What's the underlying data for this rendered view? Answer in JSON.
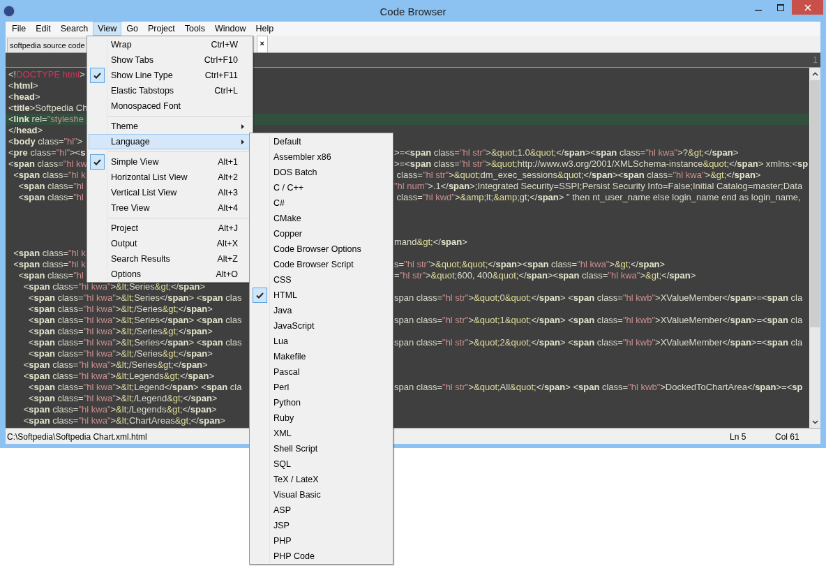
{
  "window": {
    "title": "Code Browser"
  },
  "menu_bar": [
    {
      "label": "File",
      "selected": false
    },
    {
      "label": "Edit",
      "selected": false
    },
    {
      "label": "Search",
      "selected": false
    },
    {
      "label": "View",
      "selected": true
    },
    {
      "label": "Go",
      "selected": false
    },
    {
      "label": "Project",
      "selected": false
    },
    {
      "label": "Tools",
      "selected": false
    },
    {
      "label": "Window",
      "selected": false
    },
    {
      "label": "Help",
      "selected": false
    }
  ],
  "tabs": [
    {
      "label": "softpedia source code",
      "selected": false
    },
    {
      "close": "×",
      "selected": true
    }
  ],
  "editor": {
    "header_number": "1",
    "lines": [
      {
        "left": "<!DOCTYPE html>",
        "current": false
      },
      {
        "left": "<html>",
        "current": false
      },
      {
        "left": "<head>",
        "current": false
      },
      {
        "left": "<title>Softpedia Ch",
        "current": false
      },
      {
        "left": "<link rel=\"styleshe",
        "current": true
      },
      {
        "left": "</head>",
        "current": false
      },
      {
        "left": "<body class=\"hl\">",
        "current": false
      },
      {
        "left": "<pre class=\"hl\"><s",
        "right": ">=<span class=\"hl str\">&quot;1.0&quot;</span><span class=\"hl kwa\">?&gt;</span>",
        "current": false
      },
      {
        "left": "<span class=\"hl kw",
        "right": ">=<span class=\"hl str\">&quot;http://www.w3.org/2001/XMLSchema-instance&quot;</span> xmlns:<sp",
        "current": false
      },
      {
        "left": "  <span class=\"hl k",
        "right": " class=\"hl str\">&quot;dm_exec_sessions&quot;</span><span class=\"hl kwa\">&gt;</span>",
        "current": false
      },
      {
        "left": "    <span class=\"hl",
        "right": "\"hl num\">.1</span>;Integrated Security=SSPI;Persist Security Info=False;Initial Catalog=master;Data",
        "current": false
      },
      {
        "left": "    <span class=\"hl",
        "right": " class=\"hl kwd\">&amp;lt;&amp;gt;</span> \" then nt_user_name else login_name end as login_name,",
        "current": false
      },
      {
        "current": false
      },
      {
        "current": false
      },
      {
        "current": false
      },
      {
        "right": "mand&gt;</span>",
        "current": false
      },
      {
        "left": "  <span class=\"hl k",
        "current": false
      },
      {
        "left": "  <span class=\"hl k",
        "right": "s=\"hl str\">&quot;&quot;</span><span class=\"hl kwa\">&gt;</span>",
        "current": false
      },
      {
        "left": "    <span class=\"hl",
        "right": "=\"hl str\">&quot;600, 400&quot;</span><span class=\"hl kwa\">&gt;</span>",
        "current": false
      },
      {
        "left": "      <span class=\"hl kwa\">&lt;Series&gt;</span>",
        "current": false
      },
      {
        "left": "        <span class=\"hl kwa\">&lt;Series</span> <span clas",
        "right": "span class=\"hl str\">&quot;0&quot;</span> <span class=\"hl kwb\">XValueMember</span>=<span cla",
        "current": false
      },
      {
        "left": "        <span class=\"hl kwa\">&lt;/Series&gt;</span>",
        "current": false
      },
      {
        "left": "        <span class=\"hl kwa\">&lt;Series</span> <span clas",
        "right": "span class=\"hl str\">&quot;1&quot;</span> <span class=\"hl kwb\">XValueMember</span>=<span cla",
        "current": false
      },
      {
        "left": "        <span class=\"hl kwa\">&lt;/Series&gt;</span>",
        "current": false
      },
      {
        "left": "        <span class=\"hl kwa\">&lt;Series</span> <span clas",
        "right": "span class=\"hl str\">&quot;2&quot;</span> <span class=\"hl kwb\">XValueMember</span>=<span cla",
        "current": false
      },
      {
        "left": "        <span class=\"hl kwa\">&lt;/Series&gt;</span>",
        "current": false
      },
      {
        "left": "      <span class=\"hl kwa\">&lt;/Series&gt;</span>",
        "current": false
      },
      {
        "left": "      <span class=\"hl kwa\">&lt;Legends&gt;</span>",
        "current": false
      },
      {
        "left": "        <span class=\"hl kwa\">&lt;Legend</span> <span cla",
        "right": "span class=\"hl str\">&quot;All&quot;</span> <span class=\"hl kwb\">DockedToChartArea</span>=<sp",
        "current": false
      },
      {
        "left": "        <span class=\"hl kwa\">&lt;/Legend&gt;</span>",
        "current": false
      },
      {
        "left": "      <span class=\"hl kwa\">&lt;/Legends&gt;</span>",
        "current": false
      },
      {
        "left": "      <span class=\"hl kwa\">&lt;ChartAreas&gt;</span>",
        "current": false
      }
    ]
  },
  "view_menu": {
    "items": [
      {
        "kind": "item",
        "label": "Wrap",
        "shortcut": "Ctrl+W",
        "checked": false,
        "selected": false
      },
      {
        "kind": "item",
        "label": "Show Tabs",
        "shortcut": "Ctrl+F10",
        "checked": false,
        "selected": false
      },
      {
        "kind": "item",
        "label": "Show Line Type",
        "shortcut": "Ctrl+F11",
        "checked": true,
        "selected": false
      },
      {
        "kind": "item",
        "label": "Elastic Tabstops",
        "shortcut": "Ctrl+L",
        "checked": false,
        "selected": false
      },
      {
        "kind": "item",
        "label": "Monospaced Font",
        "checked": false,
        "selected": false
      },
      {
        "kind": "separator"
      },
      {
        "kind": "submenu",
        "label": "Theme",
        "checked": false,
        "selected": false
      },
      {
        "kind": "submenu",
        "label": "Language",
        "checked": false,
        "selected": true
      },
      {
        "kind": "separator"
      },
      {
        "kind": "item",
        "label": "Simple View",
        "shortcut": "Alt+1",
        "checked": true,
        "selected": false
      },
      {
        "kind": "item",
        "label": "Horizontal List View",
        "shortcut": "Alt+2",
        "checked": false,
        "selected": false
      },
      {
        "kind": "item",
        "label": "Vertical List View",
        "shortcut": "Alt+3",
        "checked": false,
        "selected": false
      },
      {
        "kind": "item",
        "label": "Tree View",
        "shortcut": "Alt+4",
        "checked": false,
        "selected": false
      },
      {
        "kind": "separator"
      },
      {
        "kind": "item",
        "label": "Project",
        "shortcut": "Alt+J",
        "checked": false,
        "selected": false
      },
      {
        "kind": "item",
        "label": "Output",
        "shortcut": "Alt+X",
        "checked": false,
        "selected": false
      },
      {
        "kind": "item",
        "label": "Search Results",
        "shortcut": "Alt+Z",
        "checked": false,
        "selected": false
      },
      {
        "kind": "item",
        "label": "Options",
        "shortcut": "Alt+O",
        "checked": false,
        "selected": false
      }
    ]
  },
  "language_menu": {
    "items": [
      {
        "label": "Default",
        "checked": false
      },
      {
        "label": "Assembler x86",
        "checked": false
      },
      {
        "label": "DOS Batch",
        "checked": false
      },
      {
        "label": "C / C++",
        "checked": false
      },
      {
        "label": "C#",
        "checked": false
      },
      {
        "label": "CMake",
        "checked": false
      },
      {
        "label": "Copper",
        "checked": false
      },
      {
        "label": "Code Browser Options",
        "checked": false
      },
      {
        "label": "Code Browser Script",
        "checked": false
      },
      {
        "label": "CSS",
        "checked": false
      },
      {
        "label": "HTML",
        "checked": true
      },
      {
        "label": "Java",
        "checked": false
      },
      {
        "label": "JavaScript",
        "checked": false
      },
      {
        "label": "Lua",
        "checked": false
      },
      {
        "label": "Makefile",
        "checked": false
      },
      {
        "label": "Pascal",
        "checked": false
      },
      {
        "label": "Perl",
        "checked": false
      },
      {
        "label": "Python",
        "checked": false
      },
      {
        "label": "Ruby",
        "checked": false
      },
      {
        "label": "XML",
        "checked": false
      },
      {
        "label": "Shell Script",
        "checked": false
      },
      {
        "label": "SQL",
        "checked": false
      },
      {
        "label": "TeX / LateX",
        "checked": false
      },
      {
        "label": "Visual Basic",
        "checked": false
      },
      {
        "label": "ASP",
        "checked": false
      },
      {
        "label": "JSP",
        "checked": false
      },
      {
        "label": "PHP",
        "checked": false
      },
      {
        "label": "PHP Code",
        "checked": false
      }
    ]
  },
  "status_bar": {
    "path": "C:\\Softpedia\\Softpedia Chart.xml.html",
    "line": "Ln 5",
    "column": "Col 61"
  }
}
